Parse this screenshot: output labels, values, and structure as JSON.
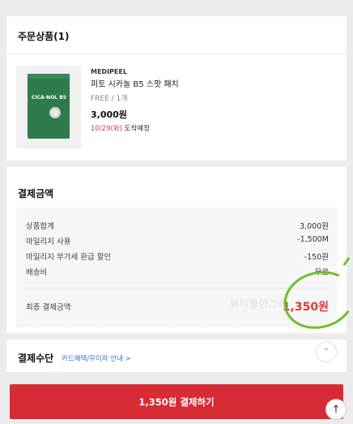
{
  "order": {
    "title": "주문상품(1)",
    "product": {
      "brand": "MEDIPEEL",
      "name": "피토 시카놀 B5 스팟 패치",
      "option": "FREE / 1개",
      "price": "3,000원",
      "eta_date": "10/29(화)",
      "eta_label": " 도착예정",
      "image_text": "CICA-NOL B5"
    }
  },
  "payment": {
    "title": "결제금액",
    "rows": [
      {
        "label": "상품합계",
        "value": "3,000원"
      },
      {
        "label": "마일리지 사용",
        "value": "-1,500M"
      },
      {
        "label": "마일리지 부가세 환급 할인",
        "value": "-150원"
      },
      {
        "label": "배송비",
        "value": "무료"
      }
    ],
    "final_label": "최종 결제금액",
    "final_value": "1,350원",
    "watermark": "뷰티몰한그리"
  },
  "method": {
    "title": "결제수단",
    "link": "카드혜택/무이자 안내 >"
  },
  "cta": {
    "label": "1,350원 결제하기"
  },
  "icons": {
    "scroll_up": "chevron-up-icon",
    "back_to_top": "arrow-up-icon"
  },
  "colors": {
    "accent": "#d72c35",
    "price_red": "#e0393e",
    "link_blue": "#3a6fd8",
    "highlight_green": "#6dbf2a"
  }
}
